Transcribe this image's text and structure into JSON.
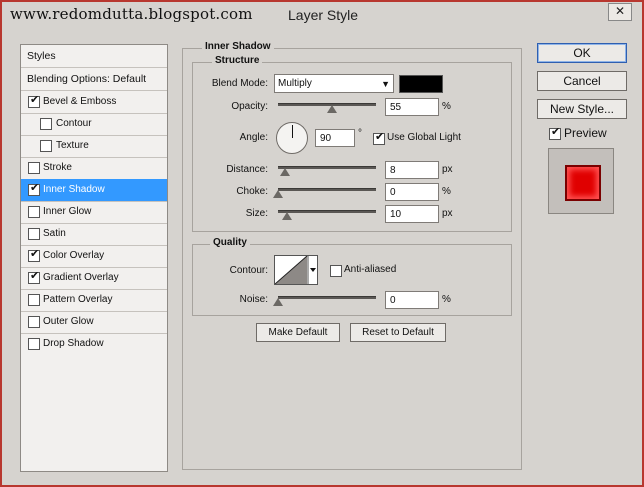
{
  "window": {
    "watermark": "www.redomdutta.blogspot.com",
    "title": "Layer Style",
    "close_glyph": "✕"
  },
  "left_panel": {
    "items": [
      {
        "label": "Styles",
        "type": "header"
      },
      {
        "label": "Blending Options: Default",
        "type": "header"
      },
      {
        "label": "Bevel & Emboss",
        "checked": true
      },
      {
        "label": "Contour",
        "checked": false,
        "indent": true
      },
      {
        "label": "Texture",
        "checked": false,
        "indent": true
      },
      {
        "label": "Stroke",
        "checked": false
      },
      {
        "label": "Inner Shadow",
        "checked": true,
        "selected": true
      },
      {
        "label": "Inner Glow",
        "checked": false
      },
      {
        "label": "Satin",
        "checked": false
      },
      {
        "label": "Color Overlay",
        "checked": true
      },
      {
        "label": "Gradient Overlay",
        "checked": true
      },
      {
        "label": "Pattern Overlay",
        "checked": false
      },
      {
        "label": "Outer Glow",
        "checked": false
      },
      {
        "label": "Drop Shadow",
        "checked": false
      }
    ]
  },
  "inner_shadow": {
    "title": "Inner Shadow",
    "structure_title": "Structure",
    "blend_mode_label": "Blend Mode:",
    "blend_mode_value": "Multiply",
    "shadow_color": "#000000",
    "opacity_label": "Opacity:",
    "opacity_value": "55",
    "opacity_unit": "%",
    "angle_label": "Angle:",
    "angle_value": "90",
    "angle_unit": "°",
    "use_global_light_label": "Use Global Light",
    "use_global_light_checked": true,
    "distance_label": "Distance:",
    "distance_value": "8",
    "distance_unit": "px",
    "choke_label": "Choke:",
    "choke_value": "0",
    "choke_unit": "%",
    "size_label": "Size:",
    "size_value": "10",
    "size_unit": "px",
    "quality_title": "Quality",
    "contour_label": "Contour:",
    "anti_aliased_label": "Anti-aliased",
    "anti_aliased_checked": false,
    "noise_label": "Noise:",
    "noise_value": "0",
    "noise_unit": "%",
    "make_default_label": "Make Default",
    "reset_default_label": "Reset to Default"
  },
  "right_buttons": {
    "ok": "OK",
    "cancel": "Cancel",
    "new_style": "New Style...",
    "preview_label": "Preview",
    "preview_checked": true
  },
  "colors": {
    "selection": "#3399ff",
    "frame_border": "#b8372f",
    "preview_fill": "#e00000"
  }
}
